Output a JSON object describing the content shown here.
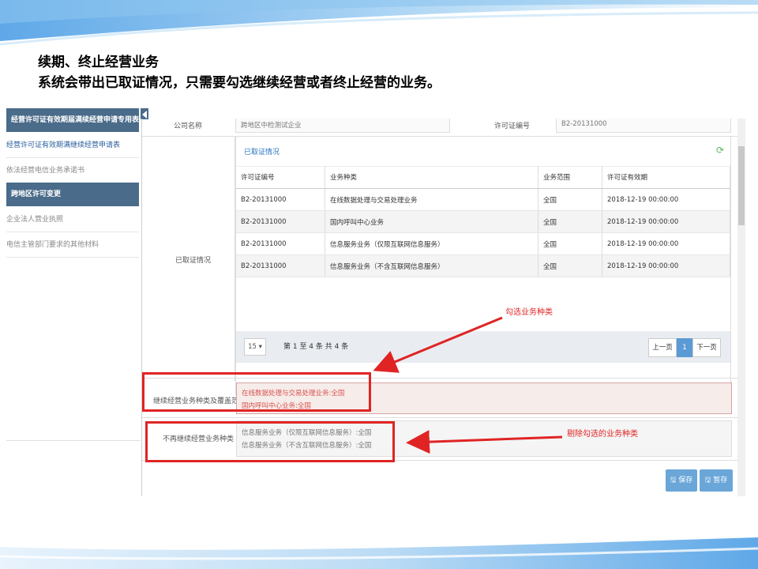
{
  "heading": {
    "line1": "续期、终止经营业务",
    "line2": "系统会带出已取证情况，只需要勾选继续经营或者终止经营的业务。"
  },
  "sidebar": {
    "items": [
      {
        "label": "经营许可证有效期届满续经营申请专用表格",
        "style": "dark"
      },
      {
        "label": "经营许可证有效期满继续经营申请表",
        "style": "link"
      },
      {
        "label": "依法经营电信业务承诺书",
        "style": "plain"
      },
      {
        "label": "跨地区许可变更",
        "style": "dark"
      },
      {
        "label": "企业法人营业执照",
        "style": "plain"
      },
      {
        "label": "电信主管部门要求的其他材料",
        "style": "plain"
      }
    ]
  },
  "form": {
    "company_label": "公司名称",
    "company_value": "跨地区中检测试企业",
    "license_label": "许可证编号",
    "license_value": "B2-20131000",
    "obtained_label": "已取证情况",
    "panel_title": "已取证情况",
    "table": {
      "headers": [
        "许可证编号",
        "业务种类",
        "业务范围",
        "许可证有效期"
      ],
      "rows": [
        [
          "B2-20131000",
          "在线数据处理与交易处理业务",
          "全国",
          "2018-12-19 00:00:00"
        ],
        [
          "B2-20131000",
          "国内呼叫中心业务",
          "全国",
          "2018-12-19 00:00:00"
        ],
        [
          "B2-20131000",
          "信息服务业务（仅限互联网信息服务）",
          "全国",
          "2018-12-19 00:00:00"
        ],
        [
          "B2-20131000",
          "信息服务业务（不含互联网信息服务）",
          "全国",
          "2018-12-19 00:00:00"
        ]
      ]
    },
    "pager": {
      "page_size": "15 ▾",
      "info": "第 1 至 4 条 共 4 条",
      "prev": "上一页",
      "current": "1",
      "next": "下一页"
    },
    "continue_label": "继续经营业务种类及覆盖范围",
    "continue_items": [
      "在线数据处理与交易处理业务:全国",
      "国内呼叫中心业务:全国"
    ],
    "stop_label": "不再继续经营业务种类",
    "stop_items": [
      "信息服务业务（仅限互联网信息服务）:全国",
      "信息服务业务（不含互联网信息服务）:全国"
    ]
  },
  "buttons": {
    "save": "保存",
    "draft": "暂存"
  },
  "annotations": {
    "select_type": "勾选业务种类",
    "remove_type": "剔除勾选的业务种类"
  },
  "colors": {
    "annotation_red": "#e02424",
    "sidebar_dark": "#4a6b8a",
    "button_blue": "#6aa6d8"
  }
}
